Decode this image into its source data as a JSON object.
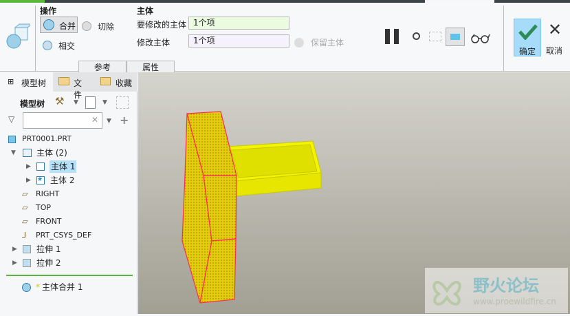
{
  "ribbon": {
    "operations_title": "操作",
    "merge": "合并",
    "cut": "切除",
    "intersect": "相交",
    "body_title": "主体",
    "bodies_to_modify_label": "要修改的主体",
    "bodies_to_modify_value": "1个项",
    "modifying_bodies_label": "修改主体",
    "modifying_bodies_value": "1个项",
    "keep_bodies": "保留主体",
    "tabs": [
      "参考",
      "属性"
    ],
    "ok": "确定",
    "cancel": "取消"
  },
  "left_panel": {
    "tabs": [
      "模型树",
      "文件",
      "收藏"
    ],
    "toolbar_title": "模型树",
    "search_placeholder": "",
    "tree": [
      {
        "label": "PRT0001.PRT"
      },
      {
        "label": "主体 (2)"
      },
      {
        "label": "主体 1",
        "selected": true
      },
      {
        "label": "主体 2"
      },
      {
        "label": "RIGHT"
      },
      {
        "label": "TOP"
      },
      {
        "label": "FRONT"
      },
      {
        "label": "PRT_CSYS_DEF"
      },
      {
        "label": "拉伸 1"
      },
      {
        "label": "拉伸 2"
      }
    ],
    "insert_item": "主体合并 1",
    "insert_marker": "*"
  },
  "watermark": {
    "title": "野火论坛",
    "url": "www.proewildfire.cn"
  },
  "colors": {
    "accent_green": "#5bb83a",
    "selection": "#b6e0f7",
    "ok_bg": "#a6dcf9",
    "part_yellow": "#f4f400",
    "edge_red": "#ff2a55"
  }
}
